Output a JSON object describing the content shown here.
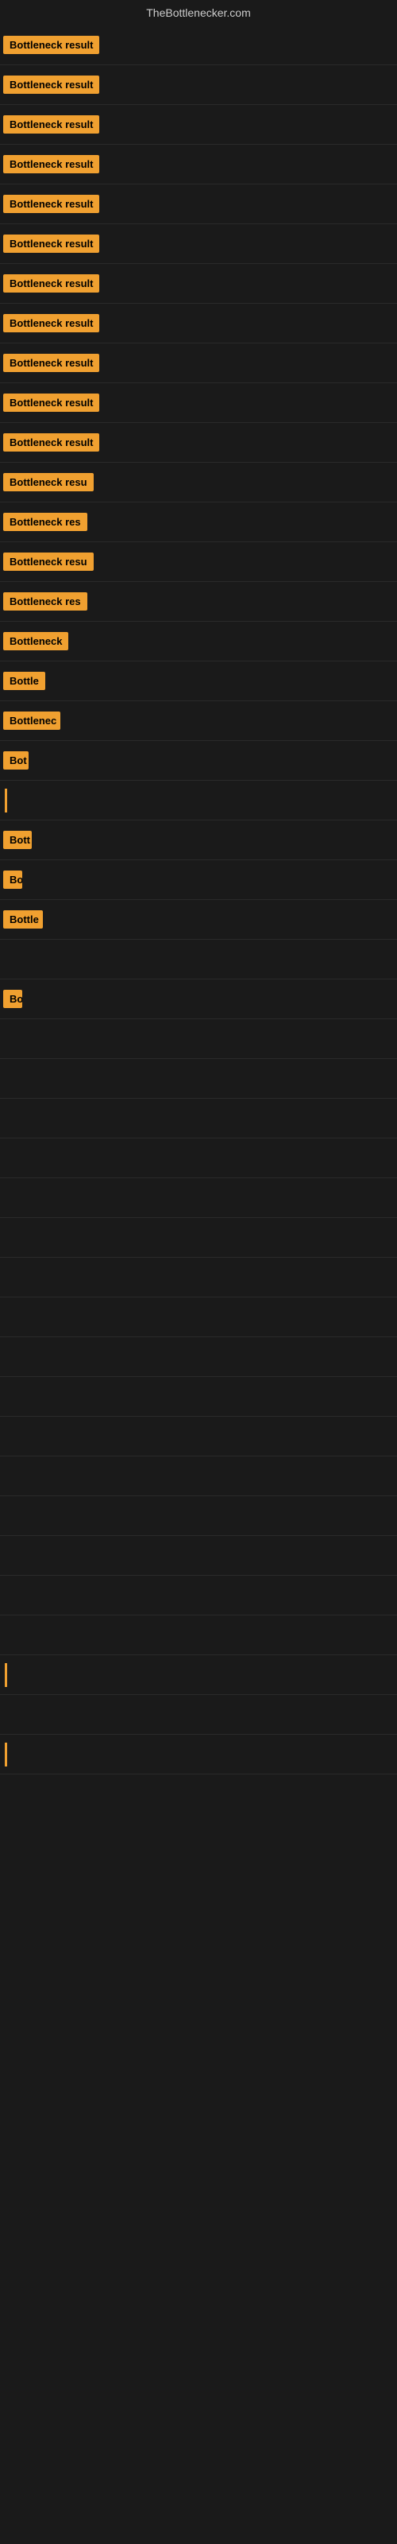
{
  "site_title": "TheBottlenecker.com",
  "badge_label": "Bottleneck result",
  "rows": [
    {
      "label": "Bottleneck result",
      "width": 155,
      "show_badge": true
    },
    {
      "label": "Bottleneck result",
      "width": 155,
      "show_badge": true
    },
    {
      "label": "Bottleneck result",
      "width": 154,
      "show_badge": true
    },
    {
      "label": "Bottleneck result",
      "width": 151,
      "show_badge": true
    },
    {
      "label": "Bottleneck result",
      "width": 150,
      "show_badge": true
    },
    {
      "label": "Bottleneck result",
      "width": 148,
      "show_badge": true
    },
    {
      "label": "Bottleneck result",
      "width": 146,
      "show_badge": true
    },
    {
      "label": "Bottleneck result",
      "width": 146,
      "show_badge": true
    },
    {
      "label": "Bottleneck result",
      "width": 144,
      "show_badge": true
    },
    {
      "label": "Bottleneck result",
      "width": 142,
      "show_badge": true
    },
    {
      "label": "Bottleneck result",
      "width": 140,
      "show_badge": true
    },
    {
      "label": "Bottleneck resu",
      "width": 120,
      "show_badge": true
    },
    {
      "label": "Bottleneck res",
      "width": 110,
      "show_badge": true
    },
    {
      "label": "Bottleneck resu",
      "width": 115,
      "show_badge": true
    },
    {
      "label": "Bottleneck res",
      "width": 108,
      "show_badge": true
    },
    {
      "label": "Bottleneck",
      "width": 85,
      "show_badge": true
    },
    {
      "label": "Bottle",
      "width": 55,
      "show_badge": true
    },
    {
      "label": "Bottlenec",
      "width": 72,
      "show_badge": true
    },
    {
      "label": "Bot",
      "width": 32,
      "show_badge": true
    },
    {
      "label": "",
      "width": 0,
      "show_badge": false,
      "show_line": true
    },
    {
      "label": "Bott",
      "width": 36,
      "show_badge": true
    },
    {
      "label": "Bo",
      "width": 24,
      "show_badge": true
    },
    {
      "label": "Bottle",
      "width": 50,
      "show_badge": true
    },
    {
      "label": "",
      "width": 0,
      "show_badge": false
    },
    {
      "label": "Bo",
      "width": 24,
      "show_badge": true
    },
    {
      "label": "",
      "width": 0,
      "show_badge": false
    },
    {
      "label": "",
      "width": 0,
      "show_badge": false
    },
    {
      "label": "",
      "width": 0,
      "show_badge": false
    },
    {
      "label": "",
      "width": 0,
      "show_badge": false
    },
    {
      "label": "",
      "width": 0,
      "show_badge": false
    },
    {
      "label": "",
      "width": 0,
      "show_badge": false
    },
    {
      "label": "",
      "width": 0,
      "show_badge": false
    },
    {
      "label": "",
      "width": 0,
      "show_badge": false
    },
    {
      "label": "",
      "width": 0,
      "show_badge": false
    },
    {
      "label": "",
      "width": 0,
      "show_badge": false
    },
    {
      "label": "",
      "width": 0,
      "show_badge": false
    },
    {
      "label": "",
      "width": 0,
      "show_badge": false
    },
    {
      "label": "",
      "width": 0,
      "show_badge": false
    },
    {
      "label": "",
      "width": 0,
      "show_badge": false
    },
    {
      "label": "",
      "width": 0,
      "show_badge": false
    },
    {
      "label": "",
      "width": 0,
      "show_badge": false
    },
    {
      "label": "",
      "width": 0,
      "show_badge": false,
      "show_line": true
    },
    {
      "label": "",
      "width": 0,
      "show_badge": false
    },
    {
      "label": "",
      "width": 0,
      "show_badge": false,
      "show_line": true
    }
  ]
}
